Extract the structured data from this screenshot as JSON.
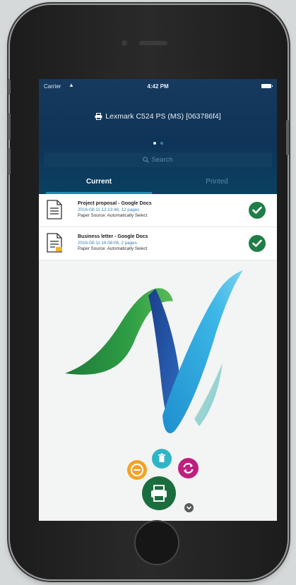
{
  "status_bar": {
    "carrier": "Carrier",
    "time": "4:42 PM"
  },
  "header": {
    "printer_name": "Lexmark C524 PS (MS) [063786f4]",
    "page_indicator": {
      "count": 2,
      "active_index": 0
    }
  },
  "search": {
    "placeholder": "Search"
  },
  "tabs": [
    {
      "label": "Current",
      "selected": true
    },
    {
      "label": "Printed",
      "selected": false
    }
  ],
  "jobs": [
    {
      "title": "Project proposal - Google Docs",
      "date": "2016-08-11 12:13:48, 12 pages",
      "source": "Paper Source: Automatically Select",
      "status": "complete"
    },
    {
      "title": "Business letter - Google Docs",
      "date": "2016-08-11 16:08:06, 2 pages",
      "source": "Paper Source: Automatically Select",
      "status": "complete"
    }
  ],
  "actions": [
    {
      "name": "cancel",
      "icon": "minus-circle-icon",
      "color": "#f2a425"
    },
    {
      "name": "delete",
      "icon": "trash-icon",
      "color": "#2fb6c6"
    },
    {
      "name": "refresh",
      "icon": "refresh-icon",
      "color": "#bf1f7f"
    },
    {
      "name": "print",
      "icon": "printer-icon",
      "color": "#1a6e3e"
    },
    {
      "name": "more",
      "icon": "chevron-down-icon",
      "color": "#5a5a5a"
    }
  ],
  "colors": {
    "header_bg": "#0e3458",
    "tab_indicator": "#1b8fb0",
    "success": "#1e7e46"
  }
}
